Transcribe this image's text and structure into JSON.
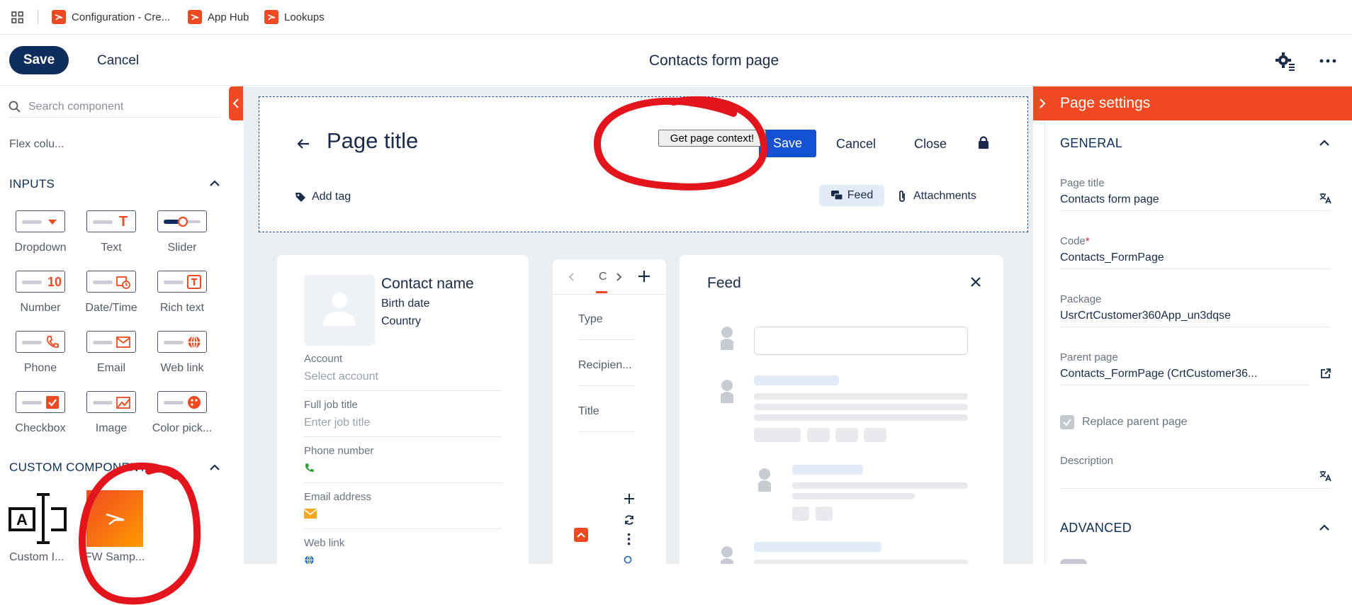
{
  "bookmarks": [
    {
      "label": "Configuration - Cre..."
    },
    {
      "label": "App Hub"
    },
    {
      "label": "Lookups"
    }
  ],
  "toolbar": {
    "save_label": "Save",
    "cancel_label": "Cancel",
    "title": "Contacts form page"
  },
  "left_panel": {
    "search_placeholder": "Search component",
    "flex_item": "Flex colu...",
    "inputs_title": "INPUTS",
    "components": [
      {
        "label": "Dropdown",
        "icon": "dropdown-icon"
      },
      {
        "label": "Text",
        "icon": "text-icon"
      },
      {
        "label": "Slider",
        "icon": "slider-icon"
      },
      {
        "label": "Number",
        "icon": "number-icon"
      },
      {
        "label": "Date/Time",
        "icon": "datetime-icon"
      },
      {
        "label": "Rich text",
        "icon": "rich-text-icon"
      },
      {
        "label": "Phone",
        "icon": "phone-icon"
      },
      {
        "label": "Email",
        "icon": "email-icon"
      },
      {
        "label": "Web link",
        "icon": "globe-icon"
      },
      {
        "label": "Checkbox",
        "icon": "checkbox-icon"
      },
      {
        "label": "Image",
        "icon": "image-icon"
      },
      {
        "label": "Color pick...",
        "icon": "palette-icon"
      }
    ],
    "number_glyph": "10",
    "text_glyph": "T",
    "custom_title": "CUSTOM COMPONENTS",
    "custom_components": [
      {
        "label": "Custom I...",
        "glyph": "A"
      },
      {
        "label": "FW Samp..."
      }
    ]
  },
  "header": {
    "page_title": "Page title",
    "context_button": "Get page context!",
    "save_label": "Save",
    "cancel_label": "Cancel",
    "close_label": "Close",
    "add_tag": "Add tag",
    "feed_label": "Feed",
    "attachments_label": "Attachments"
  },
  "contact_card": {
    "name": "Contact name",
    "birth_date": "Birth date",
    "country": "Country",
    "fields": [
      {
        "label": "Account",
        "value": "Select account"
      },
      {
        "label": "Full job title",
        "value": "Enter job title"
      },
      {
        "label": "Phone number",
        "value": ""
      },
      {
        "label": "Email address",
        "value": ""
      },
      {
        "label": "Web link",
        "value": ""
      }
    ]
  },
  "middle_card": {
    "tab_label": "C",
    "rows": [
      "Type",
      "Recipien...",
      "Title"
    ]
  },
  "feed_card": {
    "title": "Feed"
  },
  "right_panel": {
    "title": "Page settings",
    "general_title": "GENERAL",
    "fields": [
      {
        "label": "Page title",
        "value": "Contacts form page"
      },
      {
        "label": "Code",
        "value": "Contacts_FormPage",
        "required": "*"
      },
      {
        "label": "Package",
        "value": "UsrCrtCustomer360App_un3dqse"
      },
      {
        "label": "Parent page",
        "value": "Contacts_FormPage (CrtCustomer36..."
      }
    ],
    "replace_parent": "Replace parent page",
    "description_label": "Description",
    "advanced_title": "ADVANCED"
  },
  "colors": {
    "accent_orange": "#f04a23",
    "navy": "#0d2e5c",
    "primary_blue": "#1450d2",
    "annotation_red": "#e3141b"
  }
}
